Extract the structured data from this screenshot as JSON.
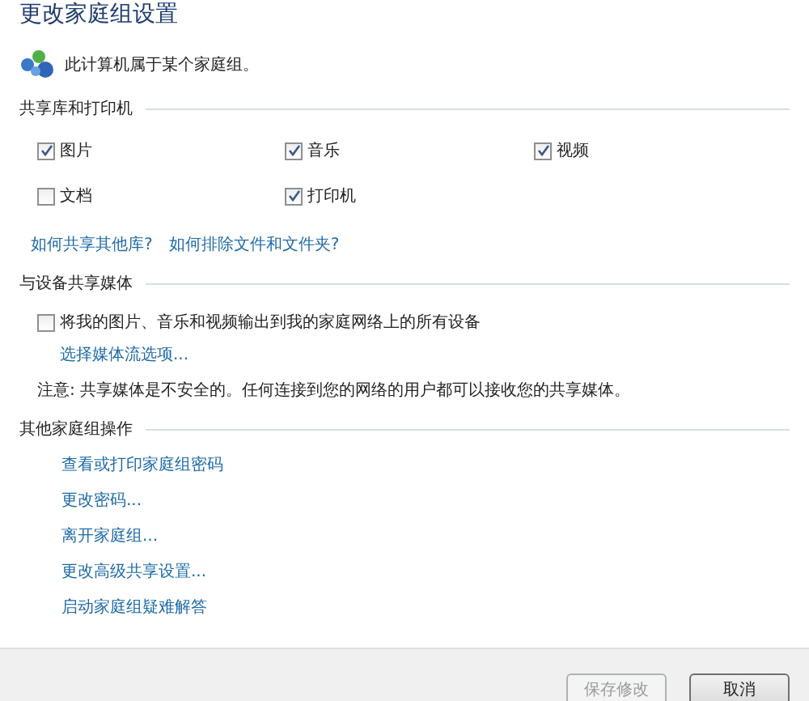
{
  "title": "更改家庭组设置",
  "membership": "此计算机属于某个家庭组。",
  "libraries": {
    "heading": "共享库和打印机",
    "items": [
      {
        "label": "图片",
        "checked": true
      },
      {
        "label": "音乐",
        "checked": true
      },
      {
        "label": "视频",
        "checked": true
      },
      {
        "label": "文档",
        "checked": false
      },
      {
        "label": "打印机",
        "checked": true
      }
    ],
    "links": [
      "如何共享其他库?",
      "如何排除文件和文件夹?"
    ]
  },
  "media": {
    "heading": "与设备共享媒体",
    "option": {
      "label": "将我的图片、音乐和视频输出到我的家庭网络上的所有设备",
      "checked": false
    },
    "link": "选择媒体流选项...",
    "note": "注意: 共享媒体是不安全的。任何连接到您的网络的用户都可以接收您的共享媒体。"
  },
  "other": {
    "heading": "其他家庭组操作",
    "links": [
      "查看或打印家庭组密码",
      "更改密码...",
      "离开家庭组...",
      "更改高级共享设置...",
      "启动家庭组疑难解答"
    ]
  },
  "buttons": [
    {
      "label": "保存修改",
      "disabled": true
    },
    {
      "label": "取消",
      "disabled": false
    }
  ]
}
